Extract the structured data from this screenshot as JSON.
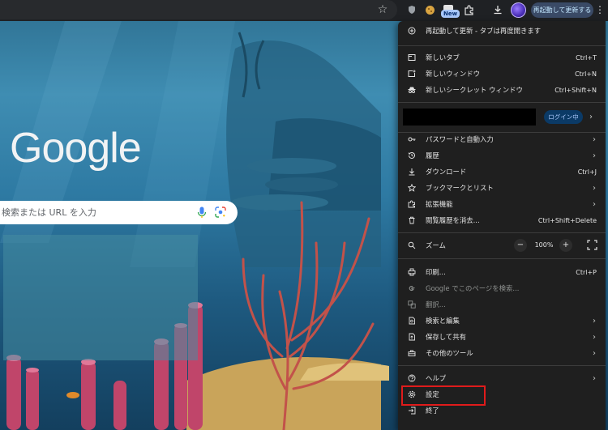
{
  "toolbar": {
    "new_badge": "New",
    "restart_button": "再起動して更新する",
    "menu_icon": "⋮"
  },
  "ntp": {
    "logo_text": "Google",
    "search_placeholder": "検索または URL を入力"
  },
  "menu": {
    "update_restart": "再起動して更新 - タブは再度開きます",
    "new_tab": "新しいタブ",
    "new_tab_shortcut": "Ctrl+T",
    "new_window": "新しいウィンドウ",
    "new_window_shortcut": "Ctrl+N",
    "new_incognito": "新しいシークレット ウィンドウ",
    "new_incognito_shortcut": "Ctrl+Shift+N",
    "login_status": "ログイン中",
    "passwords": "パスワードと自動入力",
    "history": "履歴",
    "downloads": "ダウンロード",
    "downloads_shortcut": "Ctrl+J",
    "bookmarks": "ブックマークとリスト",
    "extensions": "拡張機能",
    "clear_data": "閲覧履歴を消去...",
    "clear_data_shortcut": "Ctrl+Shift+Delete",
    "zoom": "ズーム",
    "zoom_minus": "−",
    "zoom_value": "100%",
    "zoom_plus": "+",
    "print": "印刷...",
    "print_shortcut": "Ctrl+P",
    "search_page": "Google でこのページを検索...",
    "translate": "翻訳...",
    "find_edit": "検索と編集",
    "save_share": "保存して共有",
    "more_tools": "その他のツール",
    "help": "ヘルプ",
    "settings": "設定",
    "exit": "終了"
  },
  "colors": {
    "menu_bg": "#1f1f1f",
    "highlight": "#e01b1b",
    "accent": "#a8c7fa"
  }
}
